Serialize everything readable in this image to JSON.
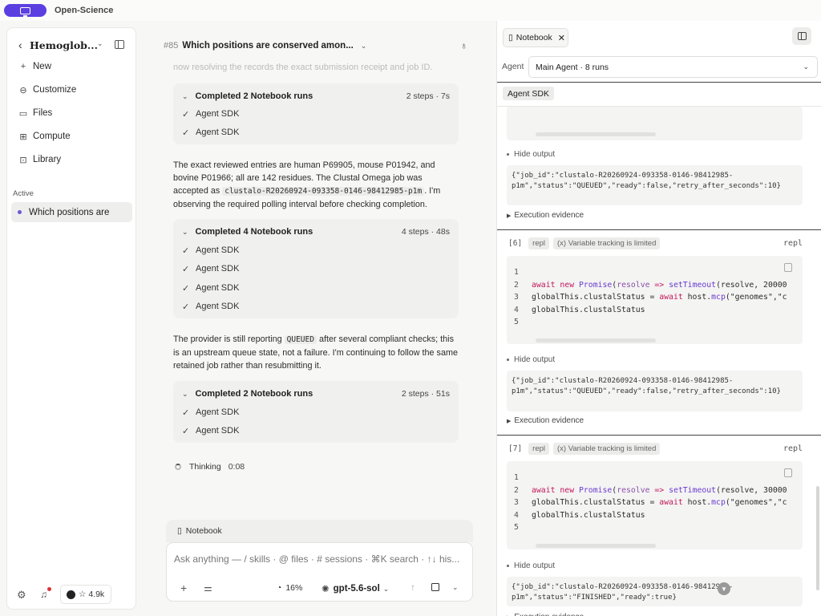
{
  "app": {
    "name": "Open-Science"
  },
  "sidebar": {
    "title": "Hemoglob...",
    "items": [
      {
        "icon": "plus-icon",
        "label": "New"
      },
      {
        "icon": "customize-icon",
        "label": "Customize"
      },
      {
        "icon": "files-icon",
        "label": "Files"
      },
      {
        "icon": "compute-icon",
        "label": "Compute"
      },
      {
        "icon": "library-icon",
        "label": "Library"
      }
    ],
    "section_label": "Active",
    "active_item": "Which positions are",
    "stars": "☆ 4.9k"
  },
  "chat": {
    "number": "#85",
    "title": "Which positions are conserved amon...",
    "faded_text": "now resolving the records the exact submission receipt and job ID.",
    "groups": [
      {
        "label": "Completed 2 Notebook runs",
        "meta": "2 steps · 7s",
        "rows": [
          "Agent SDK",
          "Agent SDK"
        ]
      },
      {
        "label": "Completed 4 Notebook runs",
        "meta": "4 steps · 48s",
        "rows": [
          "Agent SDK",
          "Agent SDK",
          "Agent SDK",
          "Agent SDK"
        ]
      },
      {
        "label": "Completed 2 Notebook runs",
        "meta": "2 steps · 51s",
        "rows": [
          "Agent SDK",
          "Agent SDK"
        ]
      }
    ],
    "para1": {
      "before": "The exact reviewed entries are human P69905, mouse P01942, and bovine P01966; all are 142 residues. The Clustal Omega job was accepted as ",
      "code": "clustalo-R20260924-093358-0146-98412985-p1m",
      "after": ". I'm observing the required polling interval before checking completion."
    },
    "para2": {
      "before": "The provider is still reporting ",
      "code": "QUEUED",
      "after": " after several compliant checks; this is an upstream queue state, not a failure. I'm continuing to follow the same retained job rather than resubmitting it."
    },
    "thinking": {
      "label": "Thinking",
      "time": "0:08"
    }
  },
  "composer": {
    "context_chip": "Notebook",
    "placeholder": "Ask anything — / skills · @ files · # sessions · ⌘K search · ↑↓ his...",
    "context_pct": "16%",
    "model": "gpt-5.6-sol"
  },
  "notebook": {
    "tab_label": "Notebook",
    "agent_label": "Agent",
    "agent_value": "Main Agent · 8 runs",
    "sdk_chip": "Agent SDK",
    "hide_output": "Hide output",
    "exec_evidence": "Execution evidence",
    "output0": "{\"job_id\":\"clustalo-R20260924-093358-0146-98412985-\np1m\",\"status\":\"QUEUED\",\"ready\":false,\"retry_after_seconds\":10}",
    "cells": [
      {
        "index": "[6]",
        "tag": "repl",
        "tracking": "(x) Variable tracking is limited",
        "lang": "repl",
        "line1": "",
        "line2_a": "await",
        "line2_b": " new ",
        "line2_c": "Promise",
        "line2_d": "(",
        "line2_e": "resolve",
        "line2_f": " => ",
        "line2_g": "setTimeout",
        "line2_h": "(resolve, 20000",
        "line3_a": "globalThis.clustalStatus = ",
        "line3_b": "await",
        "line3_c": " host.",
        "line3_d": "mcp",
        "line3_e": "(\"genomes\",\"c",
        "line4": "globalThis.clustalStatus",
        "output": "{\"job_id\":\"clustalo-R20260924-093358-0146-98412985-\np1m\",\"status\":\"QUEUED\",\"ready\":false,\"retry_after_seconds\":10}"
      },
      {
        "index": "[7]",
        "tag": "repl",
        "tracking": "(x) Variable tracking is limited",
        "lang": "repl",
        "line1": "",
        "line2_a": "await",
        "line2_b": " new ",
        "line2_c": "Promise",
        "line2_d": "(",
        "line2_e": "resolve",
        "line2_f": " => ",
        "line2_g": "setTimeout",
        "line2_h": "(resolve, 30000",
        "line3_a": "globalThis.clustalStatus = ",
        "line3_b": "await",
        "line3_c": " host.",
        "line3_d": "mcp",
        "line3_e": "(\"genomes\",\"c",
        "line4": "globalThis.clustalStatus",
        "output": "{\"job_id\":\"clustalo-R20260924-093358-0146-98412985-\np1m\",\"status\":\"FINISHED\",\"ready\":true}"
      }
    ]
  },
  "colors": {
    "accent": "#5b3fe0",
    "active_dot": "#6a58d8",
    "notify_dot": "#dd3333"
  }
}
